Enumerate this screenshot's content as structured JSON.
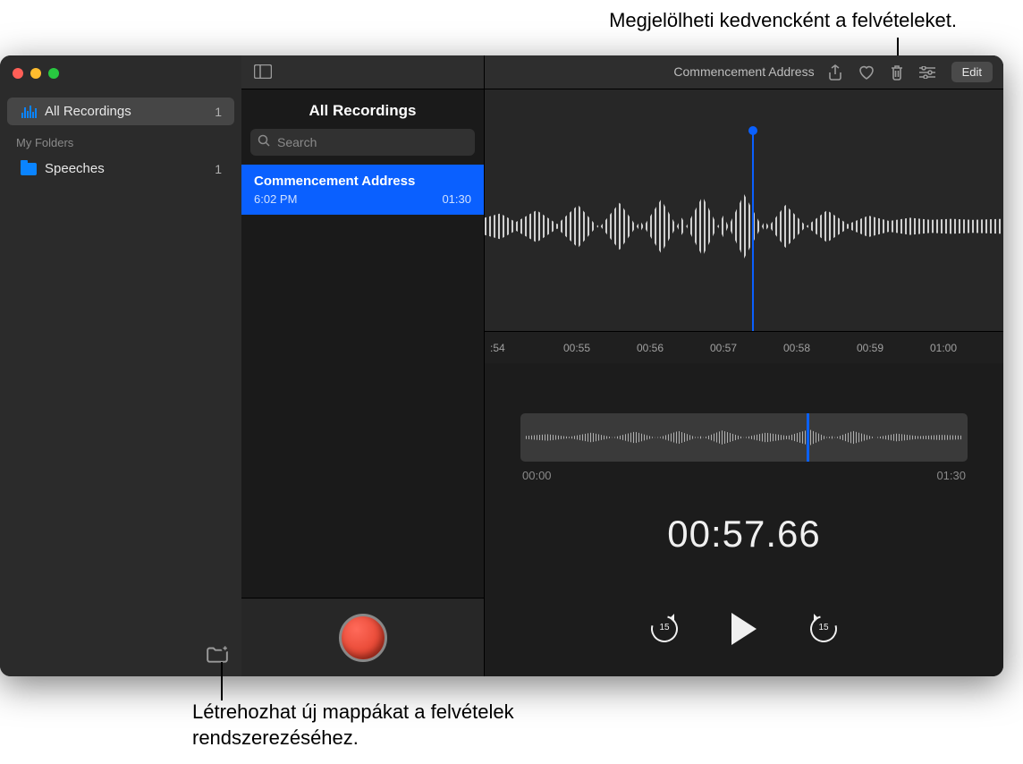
{
  "callouts": {
    "top": "Megjelölheti kedvencként a felvételeket.",
    "bottom": "Létrehozhat új mappákat a felvételek rendszerezéséhez."
  },
  "sidebar": {
    "all_recordings_label": "All Recordings",
    "all_recordings_count": "1",
    "section_label": "My Folders",
    "folders": [
      {
        "name": "Speeches",
        "count": "1"
      }
    ]
  },
  "list": {
    "title": "All Recordings",
    "search_placeholder": "Search",
    "recordings": [
      {
        "name": "Commencement Address",
        "time": "6:02 PM",
        "duration": "01:30"
      }
    ]
  },
  "toolbar": {
    "title": "Commencement Address",
    "edit_label": "Edit"
  },
  "ruler_ticks": [
    ":54",
    "00:55",
    "00:56",
    "00:57",
    "00:58",
    "00:59",
    "01:00"
  ],
  "overview": {
    "start": "00:00",
    "end": "01:30"
  },
  "current_time": "00:57.66",
  "transport": {
    "skip_back_seconds": "15",
    "skip_forward_seconds": "15"
  }
}
